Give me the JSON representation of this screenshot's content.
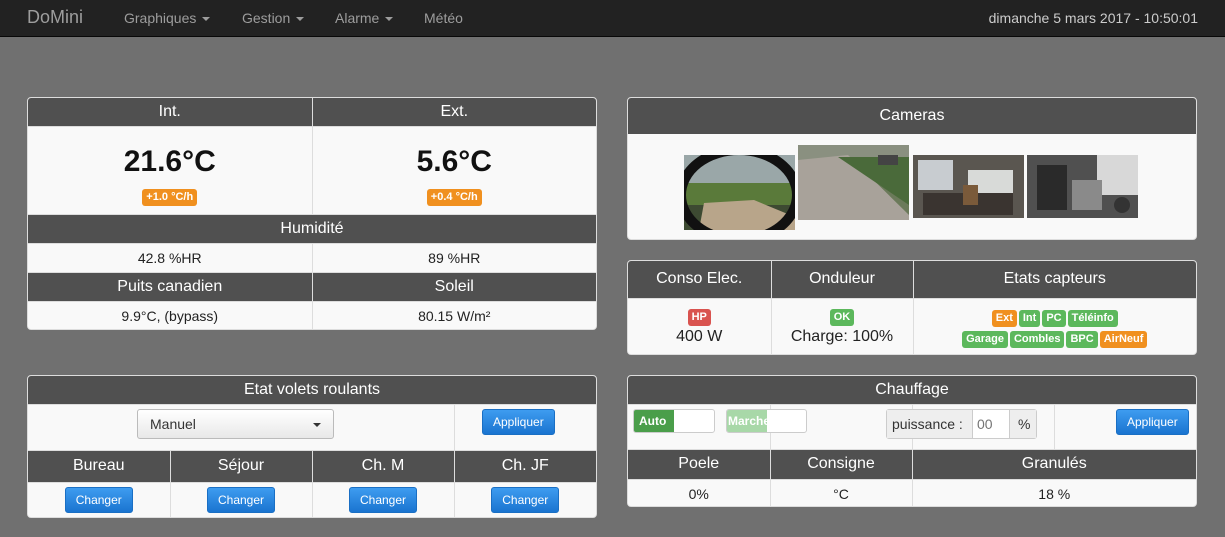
{
  "navbar": {
    "brand": "DoMini",
    "items": [
      "Graphiques",
      "Gestion",
      "Alarme",
      "Météo"
    ],
    "datetime": "dimanche 5 mars 2017 - 10:50:01"
  },
  "climate": {
    "int_header": "Int.",
    "ext_header": "Ext.",
    "int_temp": "21.6°C",
    "ext_temp": "5.6°C",
    "int_trend": "+1.0 °C/h",
    "ext_trend": "+0.4 °C/h",
    "humidity_header": "Humidité",
    "int_humidity": "42.8 %HR",
    "ext_humidity": "89 %HR",
    "puits_header": "Puits canadien",
    "soleil_header": "Soleil",
    "puits_value": "9.9°C, (bypass)",
    "soleil_value": "80.15 W/m²"
  },
  "cameras": {
    "header": "Cameras"
  },
  "status": {
    "conso_header": "Conso Elec.",
    "onduleur_header": "Onduleur",
    "capteurs_header": "Etats capteurs",
    "tariff_badge": "HP",
    "power": "400 W",
    "onduleur_badge": "OK",
    "charge": "Charge: 100%",
    "sensors": [
      {
        "label": "Ext",
        "color": "#f0901f"
      },
      {
        "label": "Int",
        "color": "#5cb85c"
      },
      {
        "label": "PC",
        "color": "#5cb85c"
      },
      {
        "label": "Téléinfo",
        "color": "#5cb85c"
      },
      {
        "label": "Garage",
        "color": "#5cb85c"
      },
      {
        "label": "Combles",
        "color": "#5cb85c"
      },
      {
        "label": "BPC",
        "color": "#5cb85c"
      },
      {
        "label": "AirNeuf",
        "color": "#f0901f"
      }
    ]
  },
  "volets": {
    "header": "Etat volets roulants",
    "mode": "Manuel",
    "apply": "Appliquer",
    "rooms": [
      "Bureau",
      "Séjour",
      "Ch. M",
      "Ch. JF"
    ],
    "change": "Changer"
  },
  "chauffage": {
    "header": "Chauffage",
    "auto": "Auto",
    "marche": "Marche",
    "puissance_label": "puissance :",
    "puissance_placeholder": "00",
    "percent": "%",
    "apply": "Appliquer",
    "poele_header": "Poele",
    "consigne_header": "Consigne",
    "granules_header": "Granulés",
    "poele": "0%",
    "consigne": "°C",
    "granules": "18 %"
  }
}
